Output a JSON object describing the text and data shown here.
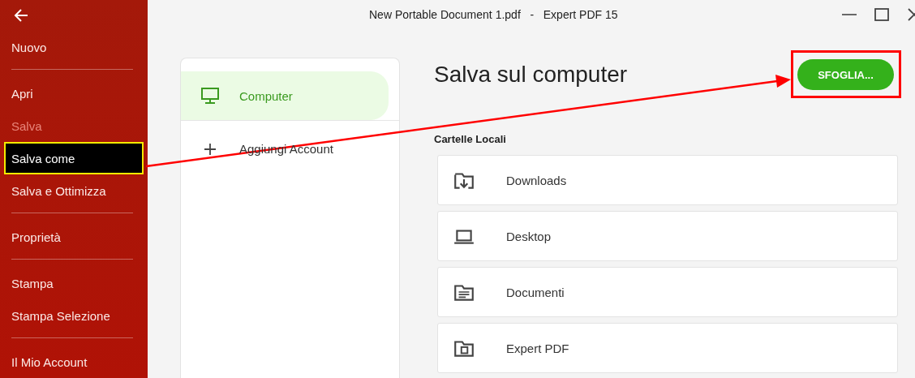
{
  "window": {
    "title": "New Portable Document 1.pdf   -   Expert PDF 15"
  },
  "sidebar": {
    "groups": [
      {
        "items": [
          {
            "label": "Nuovo",
            "selected": false,
            "disabled": false
          }
        ]
      },
      {
        "items": [
          {
            "label": "Apri",
            "selected": false,
            "disabled": false
          },
          {
            "label": "Salva",
            "selected": false,
            "disabled": true
          },
          {
            "label": "Salva come",
            "selected": true,
            "disabled": false
          },
          {
            "label": "Salva e Ottimizza",
            "selected": false,
            "disabled": false
          }
        ]
      },
      {
        "items": [
          {
            "label": "Proprietà",
            "selected": false,
            "disabled": false
          }
        ]
      },
      {
        "items": [
          {
            "label": "Stampa",
            "selected": false,
            "disabled": false
          },
          {
            "label": "Stampa Selezione",
            "selected": false,
            "disabled": false
          }
        ]
      },
      {
        "items": [
          {
            "label": "Il Mio Account",
            "selected": false,
            "disabled": false
          }
        ]
      }
    ]
  },
  "locations": [
    {
      "label": "Computer",
      "kind": "computer",
      "selected": true
    },
    {
      "label": "Aggiungi Account",
      "kind": "add",
      "selected": false
    }
  ],
  "page": {
    "heading": "Salva sul computer",
    "browse_button": "SFOGLIA...",
    "section_label": "Cartelle Locali",
    "folders": [
      {
        "label": "Downloads",
        "kind": "download"
      },
      {
        "label": "Desktop",
        "kind": "laptop"
      },
      {
        "label": "Documenti",
        "kind": "documents"
      },
      {
        "label": "Expert PDF",
        "kind": "app"
      }
    ]
  }
}
